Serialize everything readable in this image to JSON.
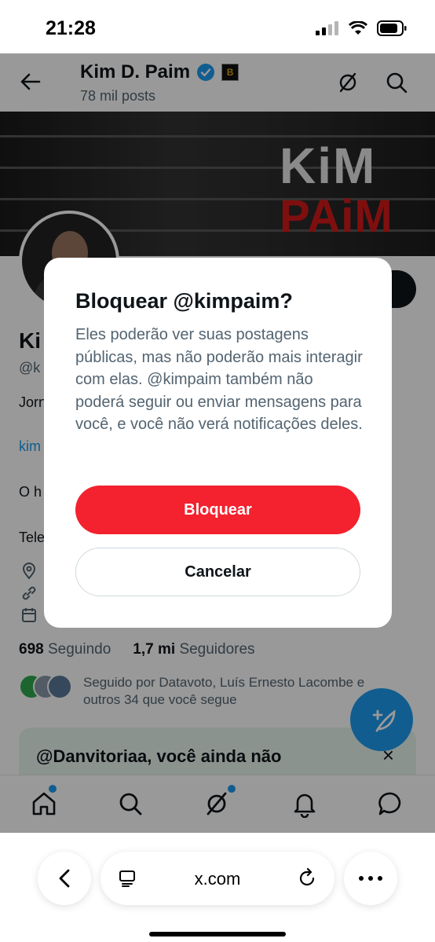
{
  "status_bar": {
    "time": "21:28"
  },
  "header": {
    "name": "Kim D. Paim",
    "posts": "78 mil posts"
  },
  "banner": {
    "line1": "KiM",
    "line2": "PAiM"
  },
  "profile": {
    "name_partial": "Ki",
    "handle_partial": "@k",
    "bio_line1": "Jorn",
    "link_partial": "kim",
    "bio_line2": "O h",
    "bio_line3": "Tele"
  },
  "stats": {
    "following_count": "698",
    "following_label": "Seguindo",
    "followers_count": "1,7 mi",
    "followers_label": "Seguidores"
  },
  "followed_by": "Seguido por Datavoto, Luís Ernesto Lacombe e outros 34 que você segue",
  "notification": {
    "title": "@Danvitoriaa, você ainda não",
    "close": "×"
  },
  "dialog": {
    "title": "Bloquear @kimpaim?",
    "body": "Eles poderão ver suas postagens públicas, mas não poderão mais interagir com elas. @kimpaim também não poderá seguir ou enviar mensagens para você, e você não verá notificações deles.",
    "block_label": "Bloquear",
    "cancel_label": "Cancelar",
    "block_color": "#f4212e"
  },
  "browser": {
    "url": "x.com"
  },
  "colors": {
    "accent": "#1d9bf0",
    "danger": "#f4212e",
    "text": "#0f1419",
    "muted": "#536471"
  }
}
